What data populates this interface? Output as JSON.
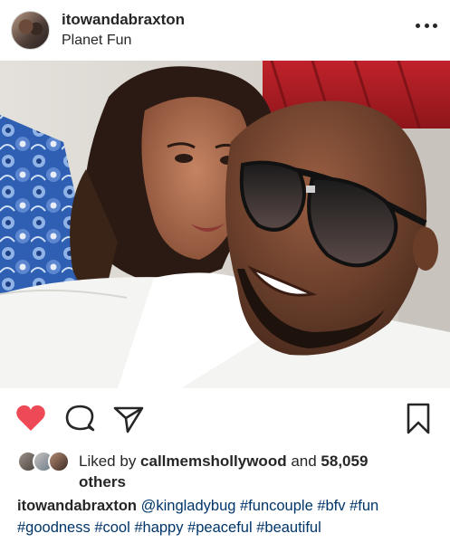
{
  "post": {
    "username": "itowandabraxton",
    "location": "Planet Fun"
  },
  "actions": {
    "like_icon": "heart-filled-icon",
    "comment_icon": "comment-icon",
    "share_icon": "send-icon",
    "save_icon": "bookmark-icon",
    "like_color": "#ed4956"
  },
  "likes": {
    "prefix": "Liked by ",
    "user": "callmemshollywood",
    "and": " and ",
    "count": "58,059",
    "suffix": "others"
  },
  "caption": {
    "user": "itowandabraxton",
    "text": "@kingladybug #funcouple #bfv #fun #goodness #cool #happy #peaceful #beautiful"
  }
}
